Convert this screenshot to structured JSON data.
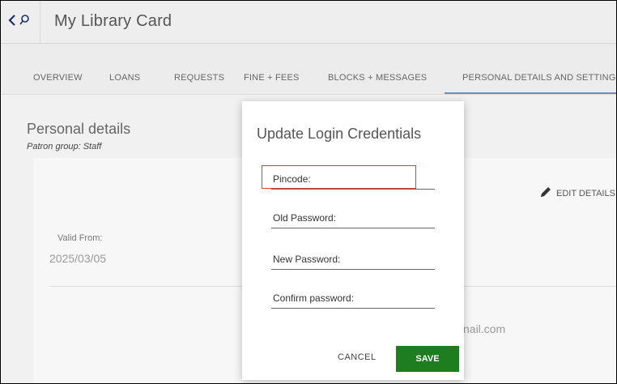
{
  "header": {
    "title": "My Library Card",
    "back_icon": "chevron-left-icon",
    "search_icon": "search-icon"
  },
  "tabs": [
    {
      "label": "OVERVIEW"
    },
    {
      "label": "LOANS"
    },
    {
      "label": "REQUESTS"
    },
    {
      "label": "FINE + FEES"
    },
    {
      "label": "BLOCKS + MESSAGES"
    },
    {
      "label": "PERSONAL DETAILS AND SETTINGS"
    }
  ],
  "active_tab": "PERSONAL DETAILS AND SETTINGS",
  "personal": {
    "title": "Personal details",
    "patron_group": "Patron group: Staff",
    "edit_label": "EDIT DETAILS",
    "valid_from_label": "Valid From:",
    "valid_from_value": "2025/03/05",
    "email_fragment": "nail.com"
  },
  "modal": {
    "title": "Update Login Credentials",
    "fields": {
      "pincode": {
        "label": "Pincode:",
        "value": ""
      },
      "old_password": {
        "label": "Old Password:",
        "value": ""
      },
      "new_password": {
        "label": "New Password:",
        "value": ""
      },
      "confirm_password": {
        "label": "Confirm password:",
        "value": ""
      }
    },
    "cancel_label": "CANCEL",
    "save_label": "SAVE"
  },
  "colors": {
    "accent": "#1f2f6b",
    "save_button": "#1e7d1e",
    "highlight": "#e53935",
    "tab_underline": "#6c8fb8"
  }
}
